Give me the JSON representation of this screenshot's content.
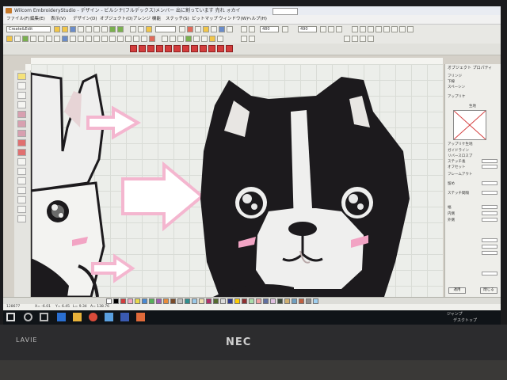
{
  "window": {
    "title": "Wilcom EmbroideryStudio - デザイン - ビルシナ(フルデックス)メンバー 出に割っています 売れ ォカイ",
    "search_value": ""
  },
  "menu": {
    "items": [
      "ファイル(F)",
      "編集(E)",
      "表示(V)",
      "デザイン(D)",
      "オブジェクト(O)",
      "アレンジ",
      "機能",
      "ステッチ(S)",
      "ビットマップ",
      "ウィンドウ(W)",
      "ヘルプ(H)"
    ]
  },
  "toolbar": {
    "design_combo": "Create&Edit",
    "size_combo": "480",
    "size_combo2": "490"
  },
  "panel": {
    "title": "オブジェクト プロパティ",
    "lines": [
      "フリンジ",
      "下線",
      "スペーシン",
      "アップリケ"
    ],
    "box_label": "生地",
    "label_up": "アップリケ生地",
    "label_guide": "ガイドライン",
    "label_fill": "リバースロスプ",
    "label_stitch": "ステッチ長",
    "label_offset": "オフセット",
    "label_frame": "フレームアウト",
    "label_tack": "留め",
    "label_spacing": "ステッチ間隔",
    "label_width": "幅",
    "label_in": "内側",
    "label_out": "外側",
    "apply_button": "適用",
    "close_button": "閉じる"
  },
  "status": {
    "count": "128677",
    "x": "X= -6.01",
    "y": "Y= 6.45",
    "l": "L= 9.34",
    "a": "A= 138.76"
  },
  "taskbar": {
    "right_text": "ジャンプ",
    "right_text2": "デスクトップ"
  },
  "bezel": {
    "left_brand": "LAVIE",
    "center_brand": "NEC"
  },
  "colors": {
    "accent": "#d33c3c",
    "arrow": "#f4b6cf",
    "dog_black": "#1c1a1d",
    "dog_white": "#efefee"
  },
  "palette": [
    "#ffffff",
    "#000000",
    "#d33c3c",
    "#f4a6c2",
    "#e8d94a",
    "#4a8ad3",
    "#57b05a",
    "#a05ab0",
    "#e88b3a",
    "#7a4b2a",
    "#c0c0c0",
    "#2f8f8f",
    "#9bc9e8",
    "#f0e0b0",
    "#b0306a",
    "#556b2f",
    "#dcdcdc",
    "#303a8f",
    "#ffcc00",
    "#8f3030",
    "#aaddaa",
    "#f0a0a0",
    "#6070a0",
    "#e0c0e0",
    "#405040",
    "#d0b070",
    "#70a0c0",
    "#c06040",
    "#909090",
    "#a0d0f0"
  ]
}
